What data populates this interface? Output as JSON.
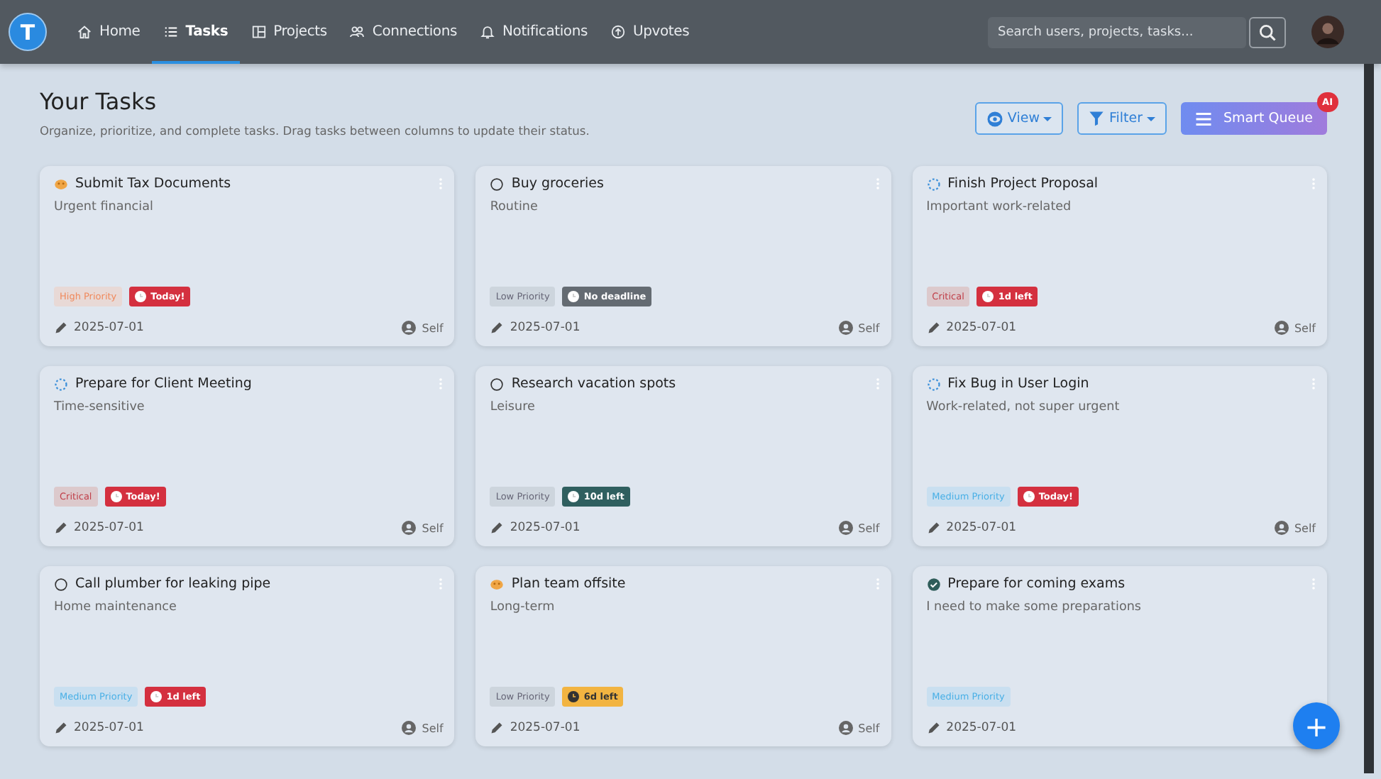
{
  "nav": {
    "logo": "T",
    "items": [
      {
        "label": "Home",
        "kind": "home",
        "selected": false
      },
      {
        "label": "Tasks",
        "kind": "list",
        "selected": true
      },
      {
        "label": "Projects",
        "kind": "board",
        "selected": false
      },
      {
        "label": "Connections",
        "kind": "people",
        "selected": false
      },
      {
        "label": "Notifications",
        "kind": "bell",
        "selected": false
      },
      {
        "label": "Upvotes",
        "kind": "upvote",
        "selected": false
      }
    ],
    "search": {
      "placeholder": "Search users, projects, tasks..."
    }
  },
  "header": {
    "title": "Your Tasks",
    "subtitle": "Organize, prioritize, and complete tasks. Drag tasks between columns to update their status.",
    "view": "View",
    "filter": "Filter",
    "smart_queue": "Smart Queue",
    "ai_badge": "AI"
  },
  "tasks": [
    {
      "title": "Submit Tax Documents",
      "kind": "paused",
      "description": "Urgent financial",
      "priority": {
        "text": "High Priority",
        "kind": "high"
      },
      "deadline": {
        "text": "Today!",
        "kind": "danger"
      },
      "date": "2025-07-01",
      "owner": "Self"
    },
    {
      "title": "Buy groceries",
      "kind": "open",
      "description": "Routine",
      "priority": {
        "text": "Low Priority",
        "kind": "low"
      },
      "deadline": {
        "text": "No deadline",
        "kind": "neutral"
      },
      "date": "2025-07-01",
      "owner": "Self"
    },
    {
      "title": "Finish Project Proposal",
      "kind": "progress",
      "description": "Important work-related",
      "priority": {
        "text": "Critical",
        "kind": "critical"
      },
      "deadline": {
        "text": "1d left",
        "kind": "danger"
      },
      "date": "2025-07-01",
      "owner": "Self"
    },
    {
      "title": "Prepare for Client Meeting",
      "kind": "progress",
      "description": "Time-sensitive",
      "priority": {
        "text": "Critical",
        "kind": "critical"
      },
      "deadline": {
        "text": "Today!",
        "kind": "danger"
      },
      "date": "2025-07-01",
      "owner": "Self"
    },
    {
      "title": "Research vacation spots",
      "kind": "open",
      "description": "Leisure",
      "priority": {
        "text": "Low Priority",
        "kind": "low"
      },
      "deadline": {
        "text": "10d left",
        "kind": "teal"
      },
      "date": "2025-07-01",
      "owner": "Self"
    },
    {
      "title": "Fix Bug in User Login",
      "kind": "progress",
      "description": "Work-related, not super urgent",
      "priority": {
        "text": "Medium Priority",
        "kind": "medium"
      },
      "deadline": {
        "text": "Today!",
        "kind": "danger"
      },
      "date": "2025-07-01",
      "owner": "Self"
    },
    {
      "title": "Call plumber for leaking pipe",
      "kind": "open",
      "description": "Home maintenance",
      "priority": {
        "text": "Medium Priority",
        "kind": "medium"
      },
      "deadline": {
        "text": "1d left",
        "kind": "danger"
      },
      "date": "2025-07-01",
      "owner": "Self"
    },
    {
      "title": "Plan team offsite",
      "kind": "paused",
      "description": "Long-term",
      "priority": {
        "text": "Low Priority",
        "kind": "low"
      },
      "deadline": {
        "text": "6d left",
        "kind": "warning"
      },
      "date": "2025-07-01",
      "owner": "Self"
    },
    {
      "title": "Prepare for coming exams",
      "kind": "done",
      "description": "I need to make some preparations",
      "priority": {
        "text": "Medium Priority",
        "kind": "medium"
      },
      "date": "2025-07-01"
    }
  ],
  "fab": "+"
}
